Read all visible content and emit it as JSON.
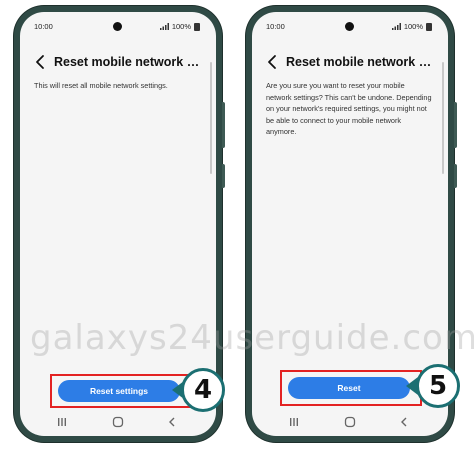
{
  "colors": {
    "accent": "#2d7de6",
    "highlight": "#e32222",
    "badge_border": "#1b6f72",
    "phone_frame": "#2f4a45"
  },
  "watermark": "galaxys24userguide.com",
  "screens": [
    {
      "status": {
        "time": "10:00",
        "battery": "100%"
      },
      "title": "Reset mobile network settings",
      "back_icon": "chevron-left-icon",
      "description": "This will reset all mobile network settings.",
      "button_label": "Reset settings",
      "step_number": "4",
      "nav_icons": [
        "recent-apps-icon",
        "home-icon",
        "back-nav-icon"
      ]
    },
    {
      "status": {
        "time": "10:00",
        "battery": "100%"
      },
      "title": "Reset mobile network settings",
      "back_icon": "chevron-left-icon",
      "description": "Are you sure you want to reset your mobile network settings? This can't be undone. Depending on your network's required settings, you might not be able to connect to your mobile network anymore.",
      "button_label": "Reset",
      "step_number": "5",
      "nav_icons": [
        "recent-apps-icon",
        "home-icon",
        "back-nav-icon"
      ]
    }
  ]
}
